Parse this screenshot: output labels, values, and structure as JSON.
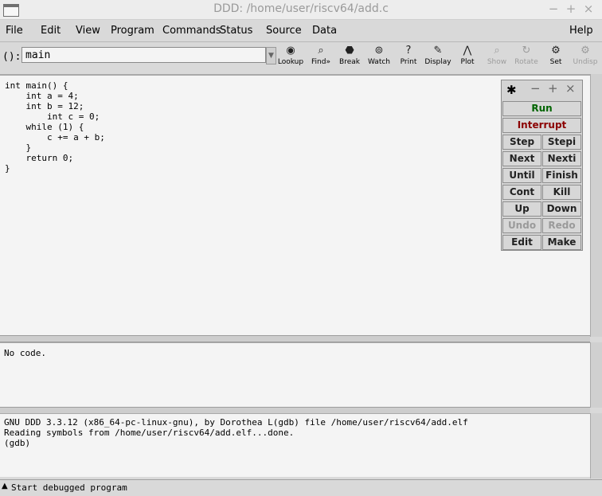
{
  "window": {
    "title": "DDD: /home/user/riscv64/add.c",
    "min": "−",
    "max": "+",
    "close": "×"
  },
  "menubar": {
    "items": [
      {
        "label": "File"
      },
      {
        "label": "Edit"
      },
      {
        "label": "View"
      },
      {
        "label": "Program"
      },
      {
        "label": "Commands"
      },
      {
        "label": "Status"
      },
      {
        "label": "Source"
      },
      {
        "label": "Data"
      }
    ],
    "help": "Help"
  },
  "toolbar": {
    "arg_label": "():",
    "arg_value": "main",
    "tools": [
      {
        "label": "Lookup",
        "icon": "lookup-icon",
        "glyph": "◉"
      },
      {
        "label": "Find»",
        "icon": "find-icon",
        "glyph": "⌕"
      },
      {
        "label": "Break",
        "icon": "break-stop-icon",
        "glyph": "⬣"
      },
      {
        "label": "Watch",
        "icon": "watch-icon",
        "glyph": "⊚"
      },
      {
        "label": "Print",
        "icon": "print-icon",
        "glyph": "?"
      },
      {
        "label": "Display",
        "icon": "display-icon",
        "glyph": "✎"
      },
      {
        "label": "Plot",
        "icon": "plot-icon",
        "glyph": "⋀"
      },
      {
        "label": "Show",
        "icon": "show-icon",
        "glyph": "⌕"
      },
      {
        "label": "Rotate",
        "icon": "rotate-icon",
        "glyph": "↻"
      },
      {
        "label": "Set",
        "icon": "set-icon",
        "glyph": "⚙"
      },
      {
        "label": "Undisp",
        "icon": "undisp-icon",
        "glyph": "⚙"
      }
    ]
  },
  "source": {
    "code": "int main() {\n    int a = 4;\n    int b = 12;\n        int c = 0;\n    while (1) {\n        c += a + b;\n    }\n    return 0;\n}"
  },
  "command_tool": {
    "run": "Run",
    "interrupt": "Interrupt",
    "buttons": [
      "Step",
      "Stepi",
      "Next",
      "Nexti",
      "Until",
      "Finish",
      "Cont",
      "Kill",
      "Up",
      "Down",
      "Undo",
      "Redo",
      "Edit",
      "Make"
    ],
    "colors": {
      "run": "#006400",
      "interrupt": "#8b0000"
    }
  },
  "code_panel": {
    "text": "No code."
  },
  "console": {
    "text": "GNU DDD 3.3.12 (x86_64-pc-linux-gnu), by Dorothea L(gdb) file /home/user/riscv64/add.elf\nReading symbols from /home/user/riscv64/add.elf...done.\n(gdb) "
  },
  "status": {
    "text": "Start debugged program"
  }
}
